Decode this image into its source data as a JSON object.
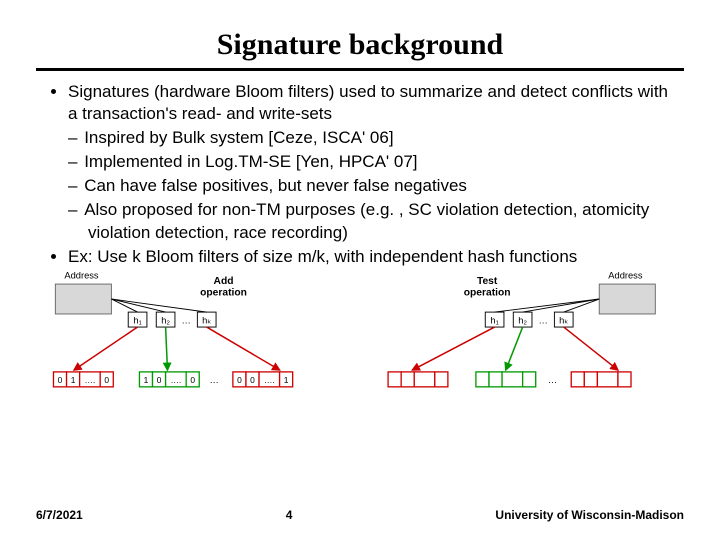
{
  "title": "Signature background",
  "bullets": {
    "b1_prefix": "Signatures (hardware Bloom filters) used to ",
    "b1_word_summarize": "summarize",
    "b1_mid": " and ",
    "b1_word_detect": "detect conflicts",
    "b1_suffix": " with a transaction's read- and write-sets",
    "s1": "Inspired by Bulk system [Ceze, ISCA' 06]",
    "s2": "Implemented in Log.TM-SE [Yen, HPCA' 07]",
    "s3": "Can have false positives, but never false negatives",
    "s4": "Also proposed for non-TM purposes (e.g. , SC violation detection, atomicity violation detection, race recording)",
    "b2": "Ex: Use k Bloom filters of size m/k, with independent hash functions"
  },
  "diagram": {
    "left_title": "Add operation",
    "right_title": "Test operation",
    "address_label": "Address",
    "hash_labels": [
      "h₁",
      "h₂",
      "hₖ"
    ],
    "ellipsis": "…",
    "cells_zero": "0",
    "cells_one": "1",
    "cells_dots": "…."
  },
  "footer": {
    "date": "6/7/2021",
    "page": "4",
    "org": "University of Wisconsin-Madison"
  }
}
